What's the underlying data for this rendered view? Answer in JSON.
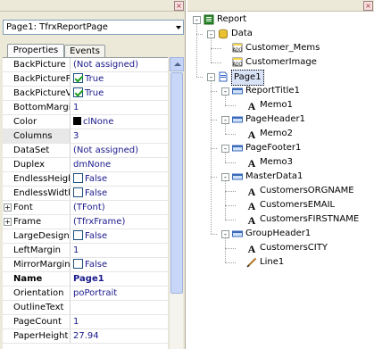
{
  "left_panel": {
    "close_glyph": "×",
    "object_selector": "Page1: TfrxReportPage",
    "tabs": [
      "Properties",
      "Events"
    ],
    "properties": [
      {
        "name": "BackPicture",
        "value": "(Not assigned)"
      },
      {
        "name": "BackPicturePr",
        "value": "True",
        "check": true
      },
      {
        "name": "BackPictureVi",
        "value": "True",
        "check": true
      },
      {
        "name": "BottomMargin",
        "value": "1"
      },
      {
        "name": "Color",
        "value": "clNone",
        "swatch": "#000000"
      },
      {
        "name": "Columns",
        "value": "3"
      },
      {
        "name": "DataSet",
        "value": "(Not assigned)"
      },
      {
        "name": "Duplex",
        "value": "dmNone"
      },
      {
        "name": "EndlessHeigh",
        "value": "False",
        "check": false
      },
      {
        "name": "EndlessWidth",
        "value": "False",
        "check": false
      },
      {
        "name": "Font",
        "value": "(TFont)",
        "expand": true
      },
      {
        "name": "Frame",
        "value": "(TfrxFrame)",
        "expand": true
      },
      {
        "name": "LargeDesignH",
        "value": "False",
        "check": false
      },
      {
        "name": "LeftMargin",
        "value": "1"
      },
      {
        "name": "MirrorMargins",
        "value": "False",
        "check": false
      },
      {
        "name": "Name",
        "value": "Page1",
        "bold": true
      },
      {
        "name": "Orientation",
        "value": "poPortrait"
      },
      {
        "name": "OutlineText",
        "value": ""
      },
      {
        "name": "PageCount",
        "value": "1"
      },
      {
        "name": "PaperHeight",
        "value": "27.94"
      }
    ]
  },
  "right_panel": {
    "close_glyph": "×",
    "tree": [
      {
        "label": "Report",
        "icon": "report-icon",
        "level": 0,
        "expand": "-"
      },
      {
        "label": "Data",
        "icon": "database-icon",
        "level": 1,
        "expand": "-"
      },
      {
        "label": "Customer_Mems",
        "icon": "dataset-icon",
        "level": 2
      },
      {
        "label": "CustomerImage",
        "icon": "dataset-icon",
        "level": 2
      },
      {
        "label": "Page1",
        "icon": "page-icon",
        "level": 1,
        "expand": "-",
        "selected": true
      },
      {
        "label": "ReportTitle1",
        "icon": "band-icon",
        "level": 2,
        "expand": "-"
      },
      {
        "label": "Memo1",
        "icon": "memo-icon",
        "level": 3
      },
      {
        "label": "PageHeader1",
        "icon": "band-icon",
        "level": 2,
        "expand": "-"
      },
      {
        "label": "Memo2",
        "icon": "memo-icon",
        "level": 3
      },
      {
        "label": "PageFooter1",
        "icon": "band-icon",
        "level": 2,
        "expand": "-"
      },
      {
        "label": "Memo3",
        "icon": "memo-icon",
        "level": 3
      },
      {
        "label": "MasterData1",
        "icon": "band-icon",
        "level": 2,
        "expand": "-"
      },
      {
        "label": "CustomersORGNAME",
        "icon": "memo-icon",
        "level": 3
      },
      {
        "label": "CustomersEMAIL",
        "icon": "memo-icon",
        "level": 3
      },
      {
        "label": "CustomersFIRSTNAME",
        "icon": "memo-icon",
        "level": 3
      },
      {
        "label": "GroupHeader1",
        "icon": "band-icon",
        "level": 2,
        "expand": "-"
      },
      {
        "label": "CustomersCITY",
        "icon": "memo-icon",
        "level": 3
      },
      {
        "label": "Line1",
        "icon": "line-icon",
        "level": 3
      }
    ]
  },
  "colors": {
    "panel_bg": "#ece9d8",
    "value_text": "#1a1a8c",
    "selection": "#d9e3f7"
  }
}
